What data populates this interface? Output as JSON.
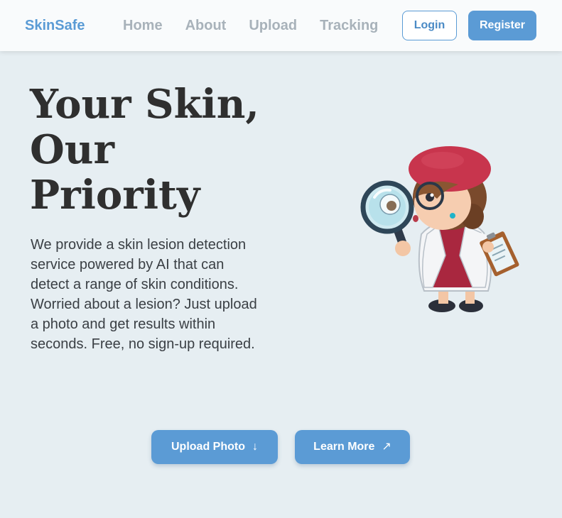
{
  "header": {
    "brand": "SkinSafe",
    "nav": [
      "Home",
      "About",
      "Upload",
      "Tracking"
    ],
    "login_label": "Login",
    "register_label": "Register"
  },
  "hero": {
    "title": "Your Skin, Our Priority",
    "description": "We provide a skin lesion detection service powered by AI that can detect a range of skin conditions. Worried about a lesion? Just upload a photo and get results within seconds. Free, no sign-up required.",
    "illustration_icon": "detective-doctor-with-magnifier-illustration"
  },
  "actions": {
    "upload_label": "Upload Photo",
    "upload_icon": "arrow-down-icon",
    "learn_label": "Learn More",
    "learn_icon": "arrow-up-right-icon"
  },
  "colors": {
    "accent": "#5b9bd5",
    "background": "#e6eef2",
    "header_bg": "#f9fbfc",
    "nav_text": "#a8b2ba",
    "heading": "#2f2f2f"
  }
}
